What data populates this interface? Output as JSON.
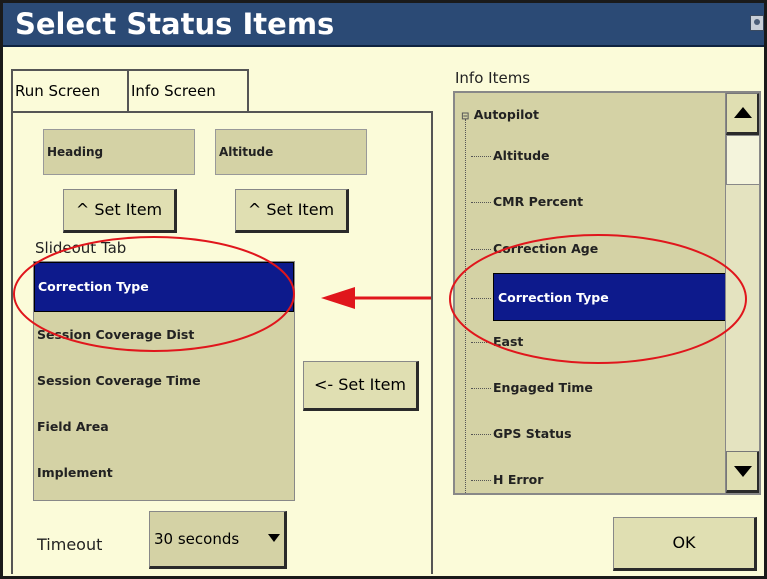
{
  "window": {
    "title": "Select Status Items",
    "camera_icon": "camera-icon"
  },
  "tabs": [
    {
      "label": "Run Screen"
    },
    {
      "label": "Info Screen"
    }
  ],
  "run_screen": {
    "slots": [
      {
        "label": "Heading"
      },
      {
        "label": "Altitude"
      }
    ],
    "set_item_up_label": "^ Set Item",
    "slideout_label": "Slideout Tab",
    "slideout_items": [
      {
        "label": "Correction Type",
        "selected": true
      },
      {
        "label": "Session Coverage Dist"
      },
      {
        "label": "Session Coverage Time"
      },
      {
        "label": "Field Area"
      },
      {
        "label": "Implement"
      }
    ],
    "set_item_left_label": "<- Set Item",
    "timeout_label": "Timeout",
    "timeout_value": "30 seconds"
  },
  "info_items": {
    "heading": "Info Items",
    "root": "Autopilot",
    "items": [
      {
        "label": "Altitude"
      },
      {
        "label": "CMR Percent"
      },
      {
        "label": "Correction Age"
      },
      {
        "label": "Correction Type",
        "selected": true
      },
      {
        "label": "East"
      },
      {
        "label": "Engaged Time"
      },
      {
        "label": "GPS Status"
      },
      {
        "label": "H Error"
      }
    ]
  },
  "ok_label": "OK",
  "colors": {
    "titlebar": "#2b4a75",
    "background": "#fbfbd9",
    "selection": "#0d1a8c",
    "annotation": "#e0161c"
  }
}
